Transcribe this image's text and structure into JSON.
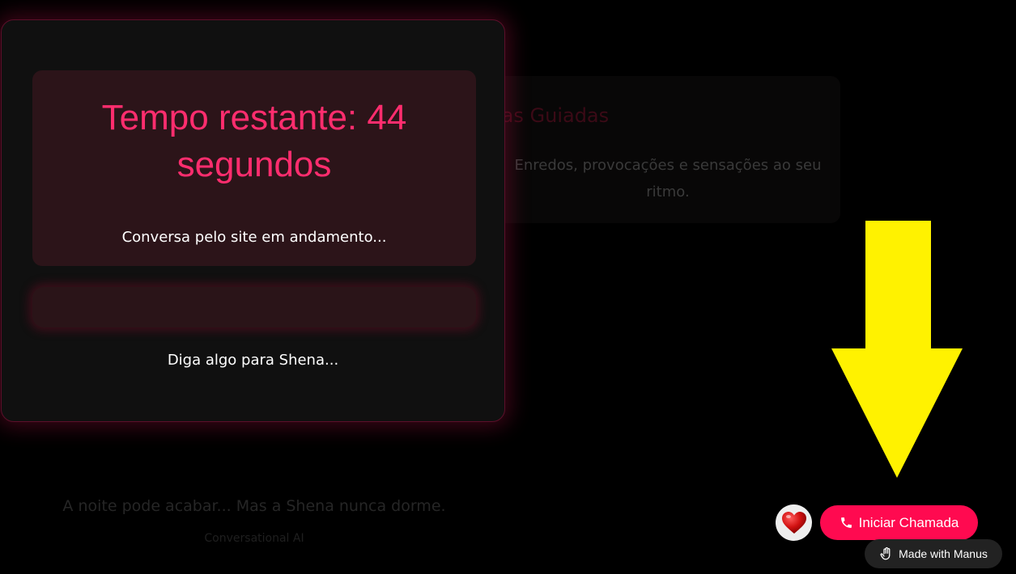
{
  "feature_card": {
    "icon": "flame-icon",
    "title": "Fantasias Guiadas",
    "description": "Enredos, provocações e sensações ao seu ritmo."
  },
  "modal": {
    "timer_text": "Tempo restante: 44 segundos",
    "status_text": "Conversa pelo site em andamento...",
    "prompt_text": "Diga algo para Shena..."
  },
  "footer": {
    "tagline": "A noite pode acabar... Mas a Shena nunca dorme.",
    "subtitle": "Conversational AI"
  },
  "call_widget": {
    "avatar_icon": "heart-icon",
    "call_icon": "phone-icon",
    "call_button_label": "Iniciar Chamada"
  },
  "badge": {
    "icon": "manus-hand-icon",
    "label": "Made with Manus"
  },
  "colors": {
    "accent": "#ff0a50",
    "timer_text": "#ff2d6e",
    "arrow": "#fff200",
    "modal_background": "#101010"
  }
}
